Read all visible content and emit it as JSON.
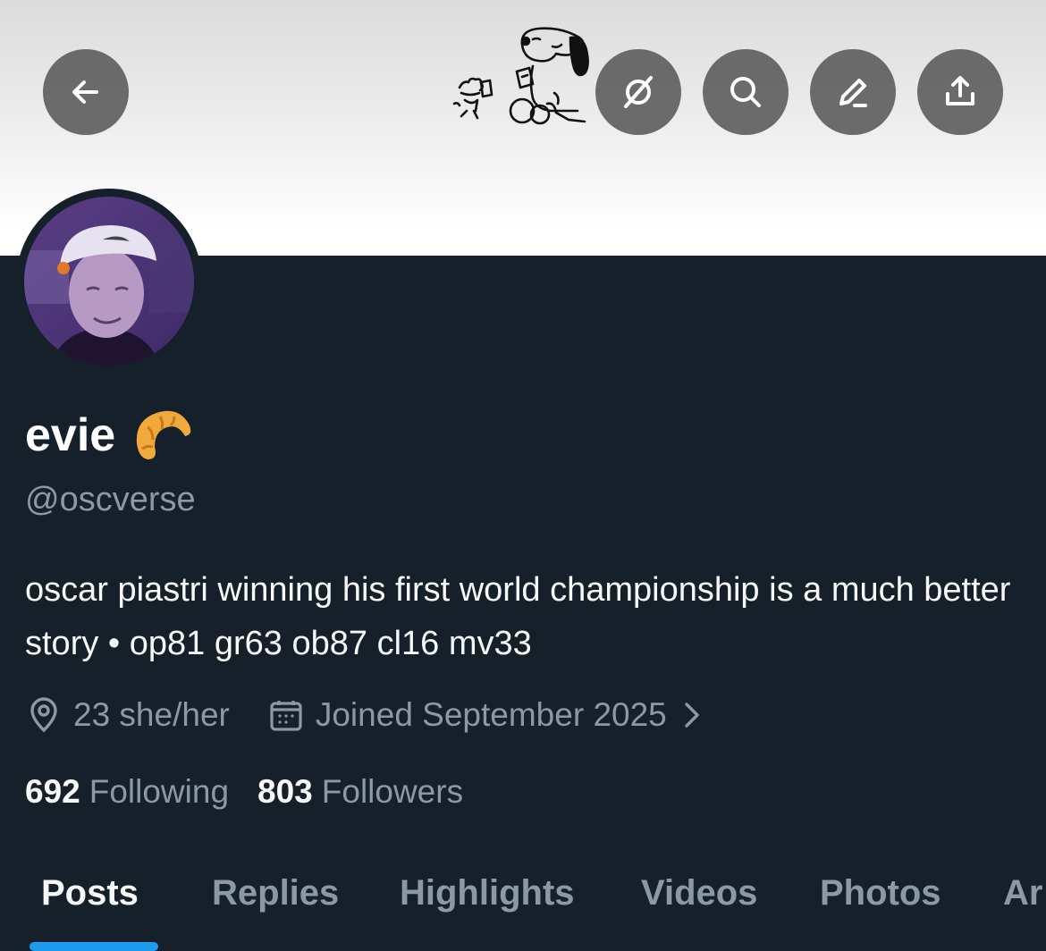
{
  "header": {
    "back_icon": "arrow-left-icon",
    "grok_icon": "grok-icon",
    "search_icon": "search-icon",
    "edit_icon": "pencil-icon",
    "share_icon": "share-icon",
    "button_color": "#606060"
  },
  "profile": {
    "display_name": "evie",
    "name_emoji": "croissant",
    "handle": "@oscverse",
    "bio": "oscar piastri winning his first world championship is a much better story • op81 gr63 ob87 cl16 mv33",
    "location": "23 she/her",
    "joined": "Joined September 2025",
    "following_count": "692",
    "following_label": "Following",
    "followers_count": "803",
    "followers_label": "Followers"
  },
  "tabs": [
    {
      "label": "Posts",
      "active": true
    },
    {
      "label": "Replies",
      "active": false
    },
    {
      "label": "Highlights",
      "active": false
    },
    {
      "label": "Videos",
      "active": false
    },
    {
      "label": "Photos",
      "active": false
    },
    {
      "label": "Ar",
      "active": false
    }
  ],
  "colors": {
    "background": "#15202b",
    "secondary_text": "#8b98a5",
    "accent": "#1d9bf0"
  }
}
